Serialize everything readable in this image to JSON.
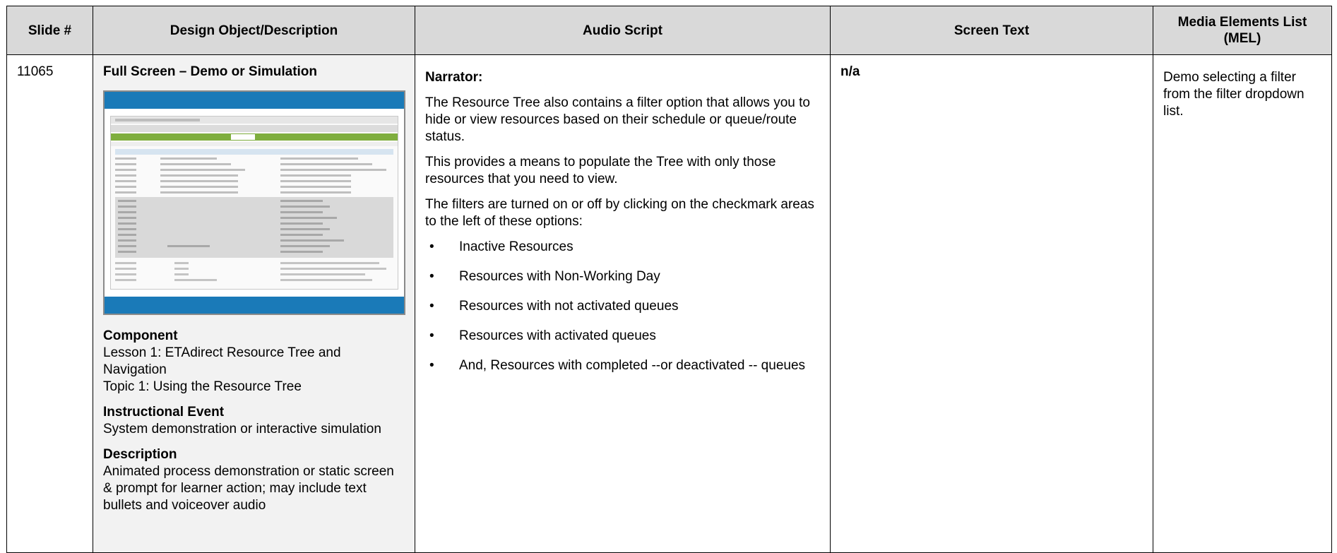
{
  "headers": {
    "slide": "Slide #",
    "design": "Design Object/Description",
    "audio": "Audio Script",
    "screen_text": "Screen Text",
    "mel": "Media Elements List (MEL)"
  },
  "row": {
    "slide_number": "11065",
    "design": {
      "title": "Full Screen – Demo or Simulation",
      "thumbnail_icon": "screenshot-thumbnail",
      "component_heading": "Component",
      "component_line1": "Lesson 1: ETAdirect Resource Tree and Navigation",
      "component_line2": "Topic 1: Using the Resource Tree",
      "event_heading": "Instructional Event",
      "event_text": "System demonstration or interactive simulation",
      "description_heading": "Description",
      "description_text": "Animated process demonstration or static screen & prompt for learner action; may include text bullets and voiceover audio"
    },
    "audio": {
      "speaker": "Narrator:",
      "paragraphs": [
        "The Resource Tree also contains a filter option that allows you to hide or view resources based on their schedule or queue/route status.",
        "This provides a means to populate the Tree with only those resources that you need to view.",
        "The filters are turned on or off by clicking on the checkmark areas to the left of these options:"
      ],
      "bullet_char": "•",
      "bullets": [
        "Inactive Resources",
        "Resources with Non-Working Day",
        "Resources with not activated queues",
        "Resources with activated queues",
        "And, Resources with completed --or deactivated -- queues"
      ]
    },
    "screen_text": "n/a",
    "mel": "Demo selecting a filter from the filter dropdown list."
  },
  "colors": {
    "header_bg": "#d9d9d9",
    "design_bg": "#f2f2f2",
    "thumb_bar": "#1a7ab8",
    "thumb_nav": "#7fae3e"
  }
}
